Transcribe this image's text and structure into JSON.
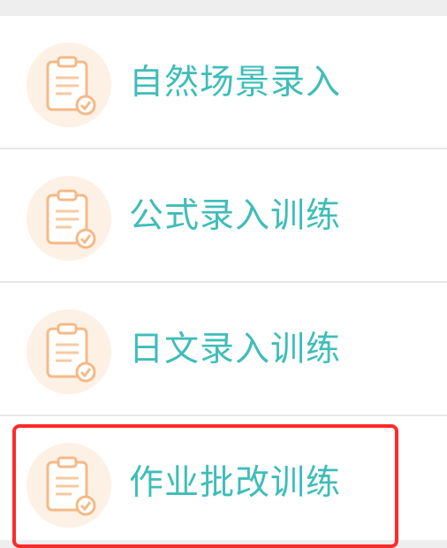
{
  "menu": {
    "items": [
      {
        "label": "自然场景录入",
        "icon": "clipboard-check-icon"
      },
      {
        "label": "公式录入训练",
        "icon": "clipboard-check-icon"
      },
      {
        "label": "日文录入训练",
        "icon": "clipboard-check-icon"
      },
      {
        "label": "作业批改训练",
        "icon": "clipboard-check-icon"
      }
    ]
  },
  "colors": {
    "label": "#3fbdb9",
    "icon_stroke": "#f5b986",
    "icon_bg": "#fdf1e6",
    "highlight": "#ff2a2a"
  }
}
